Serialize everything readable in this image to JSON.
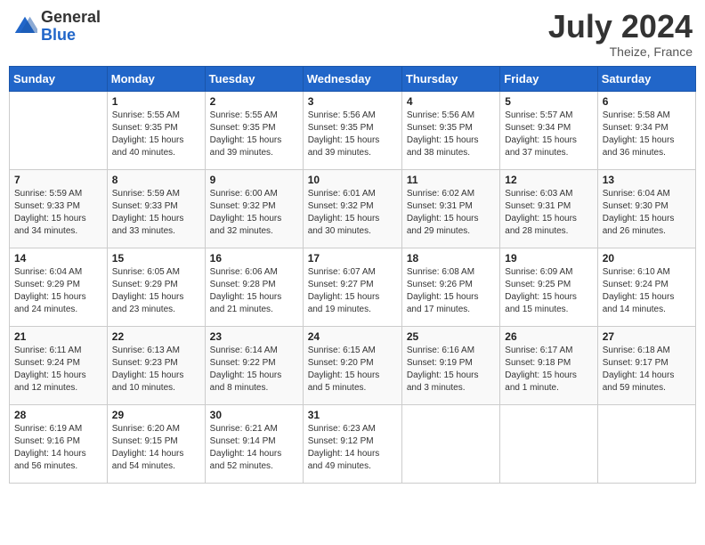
{
  "header": {
    "logo_general": "General",
    "logo_blue": "Blue",
    "month_year": "July 2024",
    "location": "Theize, France"
  },
  "days_of_week": [
    "Sunday",
    "Monday",
    "Tuesday",
    "Wednesday",
    "Thursday",
    "Friday",
    "Saturday"
  ],
  "weeks": [
    [
      {
        "day": "",
        "info": ""
      },
      {
        "day": "1",
        "info": "Sunrise: 5:55 AM\nSunset: 9:35 PM\nDaylight: 15 hours\nand 40 minutes."
      },
      {
        "day": "2",
        "info": "Sunrise: 5:55 AM\nSunset: 9:35 PM\nDaylight: 15 hours\nand 39 minutes."
      },
      {
        "day": "3",
        "info": "Sunrise: 5:56 AM\nSunset: 9:35 PM\nDaylight: 15 hours\nand 39 minutes."
      },
      {
        "day": "4",
        "info": "Sunrise: 5:56 AM\nSunset: 9:35 PM\nDaylight: 15 hours\nand 38 minutes."
      },
      {
        "day": "5",
        "info": "Sunrise: 5:57 AM\nSunset: 9:34 PM\nDaylight: 15 hours\nand 37 minutes."
      },
      {
        "day": "6",
        "info": "Sunrise: 5:58 AM\nSunset: 9:34 PM\nDaylight: 15 hours\nand 36 minutes."
      }
    ],
    [
      {
        "day": "7",
        "info": "Sunrise: 5:59 AM\nSunset: 9:33 PM\nDaylight: 15 hours\nand 34 minutes."
      },
      {
        "day": "8",
        "info": "Sunrise: 5:59 AM\nSunset: 9:33 PM\nDaylight: 15 hours\nand 33 minutes."
      },
      {
        "day": "9",
        "info": "Sunrise: 6:00 AM\nSunset: 9:32 PM\nDaylight: 15 hours\nand 32 minutes."
      },
      {
        "day": "10",
        "info": "Sunrise: 6:01 AM\nSunset: 9:32 PM\nDaylight: 15 hours\nand 30 minutes."
      },
      {
        "day": "11",
        "info": "Sunrise: 6:02 AM\nSunset: 9:31 PM\nDaylight: 15 hours\nand 29 minutes."
      },
      {
        "day": "12",
        "info": "Sunrise: 6:03 AM\nSunset: 9:31 PM\nDaylight: 15 hours\nand 28 minutes."
      },
      {
        "day": "13",
        "info": "Sunrise: 6:04 AM\nSunset: 9:30 PM\nDaylight: 15 hours\nand 26 minutes."
      }
    ],
    [
      {
        "day": "14",
        "info": "Sunrise: 6:04 AM\nSunset: 9:29 PM\nDaylight: 15 hours\nand 24 minutes."
      },
      {
        "day": "15",
        "info": "Sunrise: 6:05 AM\nSunset: 9:29 PM\nDaylight: 15 hours\nand 23 minutes."
      },
      {
        "day": "16",
        "info": "Sunrise: 6:06 AM\nSunset: 9:28 PM\nDaylight: 15 hours\nand 21 minutes."
      },
      {
        "day": "17",
        "info": "Sunrise: 6:07 AM\nSunset: 9:27 PM\nDaylight: 15 hours\nand 19 minutes."
      },
      {
        "day": "18",
        "info": "Sunrise: 6:08 AM\nSunset: 9:26 PM\nDaylight: 15 hours\nand 17 minutes."
      },
      {
        "day": "19",
        "info": "Sunrise: 6:09 AM\nSunset: 9:25 PM\nDaylight: 15 hours\nand 15 minutes."
      },
      {
        "day": "20",
        "info": "Sunrise: 6:10 AM\nSunset: 9:24 PM\nDaylight: 15 hours\nand 14 minutes."
      }
    ],
    [
      {
        "day": "21",
        "info": "Sunrise: 6:11 AM\nSunset: 9:24 PM\nDaylight: 15 hours\nand 12 minutes."
      },
      {
        "day": "22",
        "info": "Sunrise: 6:13 AM\nSunset: 9:23 PM\nDaylight: 15 hours\nand 10 minutes."
      },
      {
        "day": "23",
        "info": "Sunrise: 6:14 AM\nSunset: 9:22 PM\nDaylight: 15 hours\nand 8 minutes."
      },
      {
        "day": "24",
        "info": "Sunrise: 6:15 AM\nSunset: 9:20 PM\nDaylight: 15 hours\nand 5 minutes."
      },
      {
        "day": "25",
        "info": "Sunrise: 6:16 AM\nSunset: 9:19 PM\nDaylight: 15 hours\nand 3 minutes."
      },
      {
        "day": "26",
        "info": "Sunrise: 6:17 AM\nSunset: 9:18 PM\nDaylight: 15 hours\nand 1 minute."
      },
      {
        "day": "27",
        "info": "Sunrise: 6:18 AM\nSunset: 9:17 PM\nDaylight: 14 hours\nand 59 minutes."
      }
    ],
    [
      {
        "day": "28",
        "info": "Sunrise: 6:19 AM\nSunset: 9:16 PM\nDaylight: 14 hours\nand 56 minutes."
      },
      {
        "day": "29",
        "info": "Sunrise: 6:20 AM\nSunset: 9:15 PM\nDaylight: 14 hours\nand 54 minutes."
      },
      {
        "day": "30",
        "info": "Sunrise: 6:21 AM\nSunset: 9:14 PM\nDaylight: 14 hours\nand 52 minutes."
      },
      {
        "day": "31",
        "info": "Sunrise: 6:23 AM\nSunset: 9:12 PM\nDaylight: 14 hours\nand 49 minutes."
      },
      {
        "day": "",
        "info": ""
      },
      {
        "day": "",
        "info": ""
      },
      {
        "day": "",
        "info": ""
      }
    ]
  ]
}
